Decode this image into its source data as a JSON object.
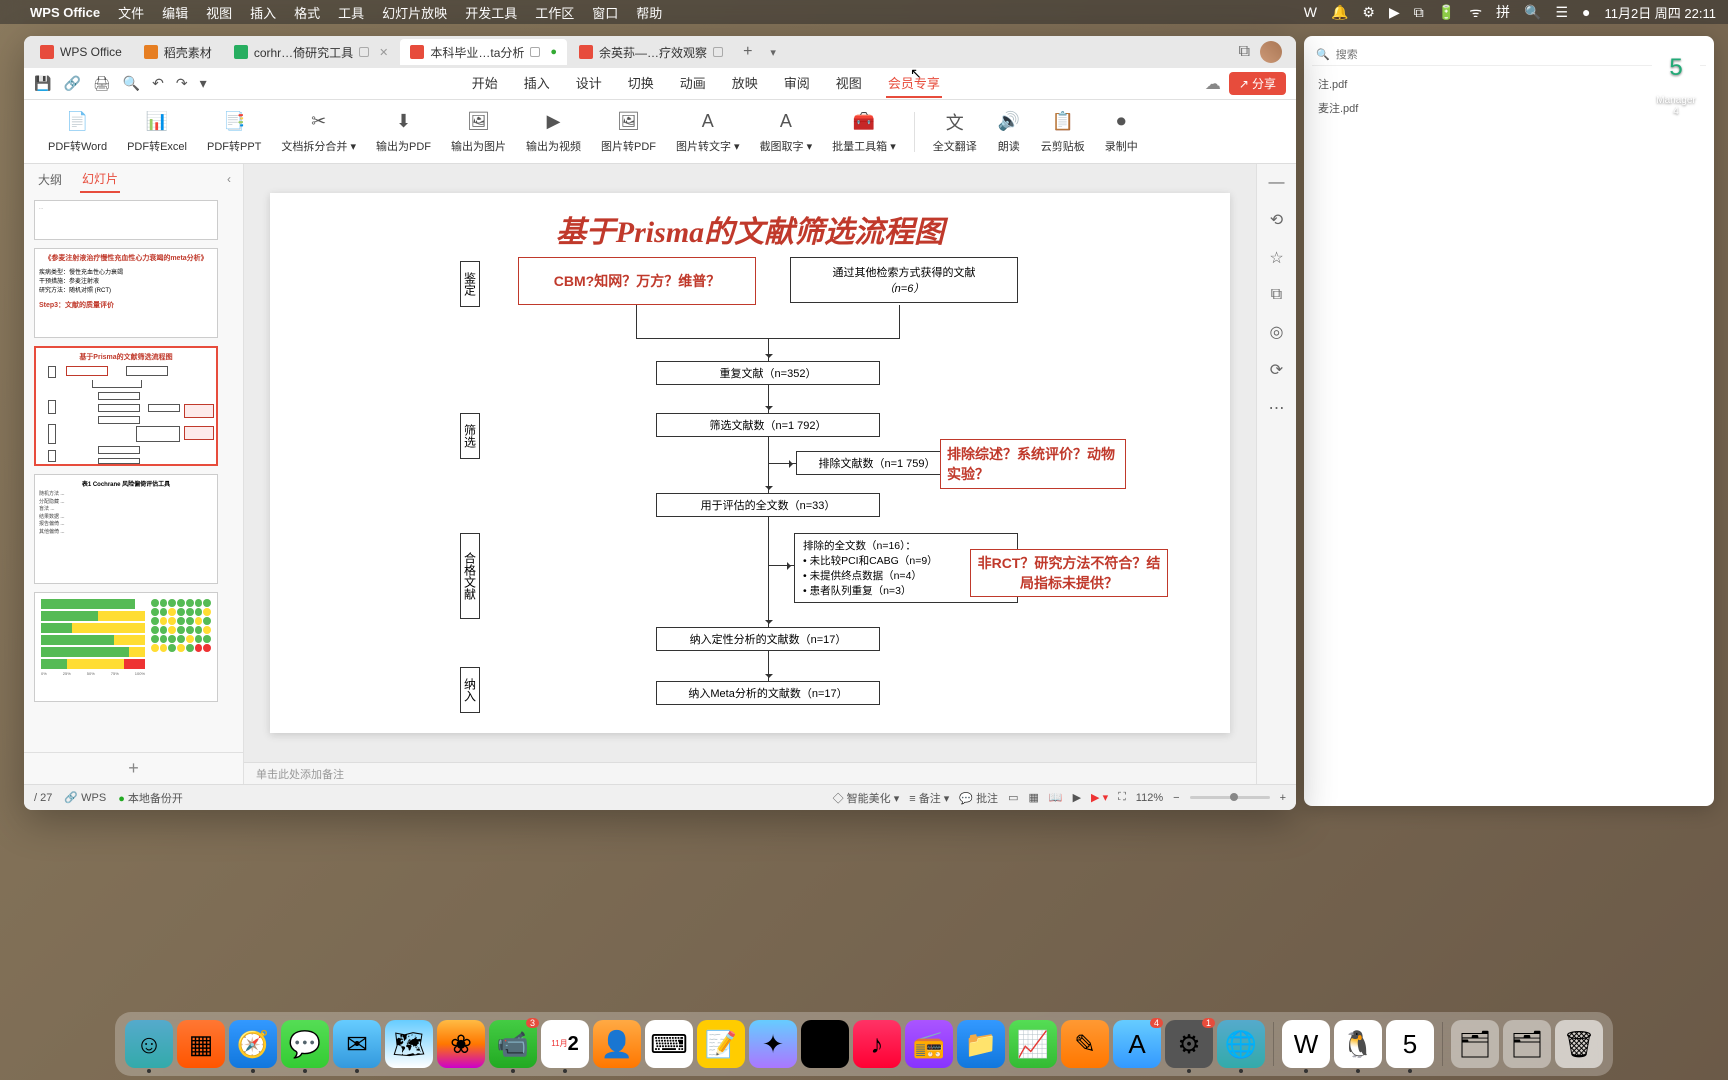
{
  "menubar": {
    "apple": "",
    "appname": "WPS Office",
    "items": [
      "文件",
      "编辑",
      "视图",
      "插入",
      "格式",
      "工具",
      "幻灯片放映",
      "开发工具",
      "工作区",
      "窗口",
      "帮助"
    ],
    "right_icons": [
      "W",
      "🔔",
      "⚙",
      "▶",
      "⧉",
      "🔋",
      "ᯤ",
      "拼",
      "🔍",
      "☰",
      "●"
    ],
    "date": "11月2日 周四 22:11"
  },
  "tabs": [
    {
      "icon_color": "#e74c3c",
      "label": "WPS Office"
    },
    {
      "icon_color": "#e67e22",
      "label": "稻壳素材"
    },
    {
      "icon_color": "#27ae60",
      "label": "corhr…倚研究工具",
      "closable": true
    },
    {
      "icon_color": "#e74c3c",
      "label": "本科毕业…ta分析",
      "closable": true,
      "active": true
    },
    {
      "icon_color": "#e74c3c",
      "label": "余英荪—…疗效观察",
      "closable": true
    }
  ],
  "qa": {
    "icons": [
      "💾",
      "🔗",
      "🖨",
      "🔍",
      "↶",
      "↷",
      "▾"
    ],
    "share": "分享"
  },
  "ribbon_tabs": [
    "开始",
    "插入",
    "设计",
    "切换",
    "动画",
    "放映",
    "审阅",
    "视图",
    "会员专享"
  ],
  "ribbon_items": [
    {
      "icon": "📄",
      "label": "PDF转Word"
    },
    {
      "icon": "📊",
      "label": "PDF转Excel"
    },
    {
      "icon": "📑",
      "label": "PDF转PPT"
    },
    {
      "icon": "✂",
      "label": "文档拆分合并 ▾"
    },
    {
      "icon": "⬇",
      "label": "输出为PDF"
    },
    {
      "icon": "🖼",
      "label": "输出为图片"
    },
    {
      "icon": "▶",
      "label": "输出为视频"
    },
    {
      "icon": "🖼",
      "label": "图片转PDF"
    },
    {
      "icon": "A",
      "label": "图片转文字 ▾"
    },
    {
      "icon": "A",
      "label": "截图取字 ▾"
    },
    {
      "icon": "🧰",
      "label": "批量工具箱 ▾"
    },
    {
      "sep": true
    },
    {
      "icon": "文",
      "label": "全文翻译"
    },
    {
      "icon": "🔊",
      "label": "朗读"
    },
    {
      "icon": "📋",
      "label": "云剪贴板"
    },
    {
      "icon": "⏺",
      "label": "录制中"
    }
  ],
  "slidepanel": {
    "tabs": [
      "大纲",
      "幻灯片"
    ],
    "thumbs": [
      {
        "type": "text",
        "title": "…"
      },
      {
        "type": "text",
        "title": "《参麦注射液治疗慢性充血性心力衰竭的meta分析》",
        "body": "疾病类型：慢性充血性心力衰竭\n干预措施：参麦注射液\n研究方法：随机对照 (RCT)",
        "footer": "Step3：文献的质量评价"
      },
      {
        "type": "flow",
        "title": "基于Prisma的文献筛选流程图",
        "selected": true
      },
      {
        "type": "table",
        "title": "表1 Cochrane 风险偏倚评估工具"
      },
      {
        "type": "chart",
        "title": ""
      }
    ]
  },
  "slide": {
    "title": "基于Prisma的文献筛选流程图",
    "stage_labels": [
      "鉴定",
      "筛选",
      "合格文献",
      "纳入"
    ],
    "boxes": {
      "src1": "CBM?知网？万方？维普？",
      "src2_l1": "通过其他检索方式获得的文献",
      "src2_l2": "（n=6）",
      "dup": "重复文献（n=352）",
      "screened": "筛选文献数（n=1 792）",
      "excluded1": "排除文献数（n=1 759）",
      "note1": "排除综述？系统评价？动物实验？",
      "fulltext": "用于评估的全文数（n=33）",
      "excluded2_l1": "排除的全文数（n=16）：",
      "excluded2_l2": "• 未比较PCI和CABG（n=9）",
      "excluded2_l3": "• 未提供终点数据（n=4）",
      "excluded2_l4": "• 患者队列重复（n=3）",
      "note2": "非RCT？研究方法不符合？结局指标未提供？",
      "qual": "纳入定性分析的文献数（n=17）",
      "meta": "纳入Meta分析的文献数（n=17）"
    }
  },
  "notes_placeholder": "单击此处添加备注",
  "rside_icons": [
    "—",
    "⟲",
    "☆",
    "⧉",
    "◎",
    "⟳",
    "⋯"
  ],
  "statusbar": {
    "page": "/ 27",
    "wps": "WPS",
    "backup": "本地备份开",
    "smart": "智能美化",
    "notes": "备注",
    "comments": "批注",
    "zoom": "112%"
  },
  "bg_window": {
    "title": "Manager",
    "version": "4",
    "search_placeholder": "搜索",
    "files": [
      "注.pdf",
      "麦注.pdf"
    ]
  },
  "desktop": {
    "app_label": "5"
  },
  "dock": [
    {
      "bg": "linear-gradient(#5ac,#3aa)",
      "glyph": "☺",
      "running": true
    },
    {
      "bg": "linear-gradient(#f73,#f50)",
      "glyph": "▦"
    },
    {
      "bg": "linear-gradient(#39f,#17d)",
      "glyph": "🧭",
      "running": true
    },
    {
      "bg": "linear-gradient(#5d5,#3c3)",
      "glyph": "💬",
      "running": true
    },
    {
      "bg": "linear-gradient(#6cf,#39d)",
      "glyph": "✉",
      "running": true
    },
    {
      "bg": "linear-gradient(#6cf,#fff)",
      "glyph": "🗺"
    },
    {
      "bg": "linear-gradient(#fb4,#f70,#c0c)",
      "glyph": "❀"
    },
    {
      "bg": "linear-gradient(#4c4,#2a2)",
      "glyph": "📹",
      "badge": "3",
      "running": true
    },
    {
      "bg": "#fff",
      "glyph": "2",
      "text": "11月",
      "running": true
    },
    {
      "bg": "linear-gradient(#fa4,#f70)",
      "glyph": "👤"
    },
    {
      "bg": "#fff",
      "glyph": "⌨"
    },
    {
      "bg": "#fc0",
      "glyph": "📝"
    },
    {
      "bg": "linear-gradient(#6cf,#a7f)",
      "glyph": "✦"
    },
    {
      "bg": "#000",
      "glyph": "tv"
    },
    {
      "bg": "linear-gradient(#f36,#f03)",
      "glyph": "♪"
    },
    {
      "bg": "linear-gradient(#a5f,#83f)",
      "glyph": "📻"
    },
    {
      "bg": "linear-gradient(#39f,#17d)",
      "glyph": "📁"
    },
    {
      "bg": "linear-gradient(#5d5,#3b3)",
      "glyph": "📈"
    },
    {
      "bg": "linear-gradient(#f93,#f70)",
      "glyph": "✎"
    },
    {
      "bg": "linear-gradient(#6cf,#39f)",
      "glyph": "A",
      "badge": "4"
    },
    {
      "bg": "#555",
      "glyph": "⚙",
      "badge": "1",
      "running": true
    },
    {
      "bg": "linear-gradient(#5ac,#3aa)",
      "glyph": "🌐",
      "running": true
    },
    {
      "sep": true
    },
    {
      "bg": "#fff",
      "glyph": "W",
      "running": true
    },
    {
      "bg": "#fff",
      "glyph": "🐧",
      "running": true
    },
    {
      "bg": "#fff",
      "glyph": "5",
      "running": true
    },
    {
      "sep": true
    },
    {
      "bg": "rgba(255,255,255,0.4)",
      "glyph": "🗂"
    },
    {
      "bg": "rgba(255,255,255,0.4)",
      "glyph": "🗂"
    },
    {
      "bg": "rgba(255,255,255,0.6)",
      "glyph": "🗑"
    }
  ]
}
